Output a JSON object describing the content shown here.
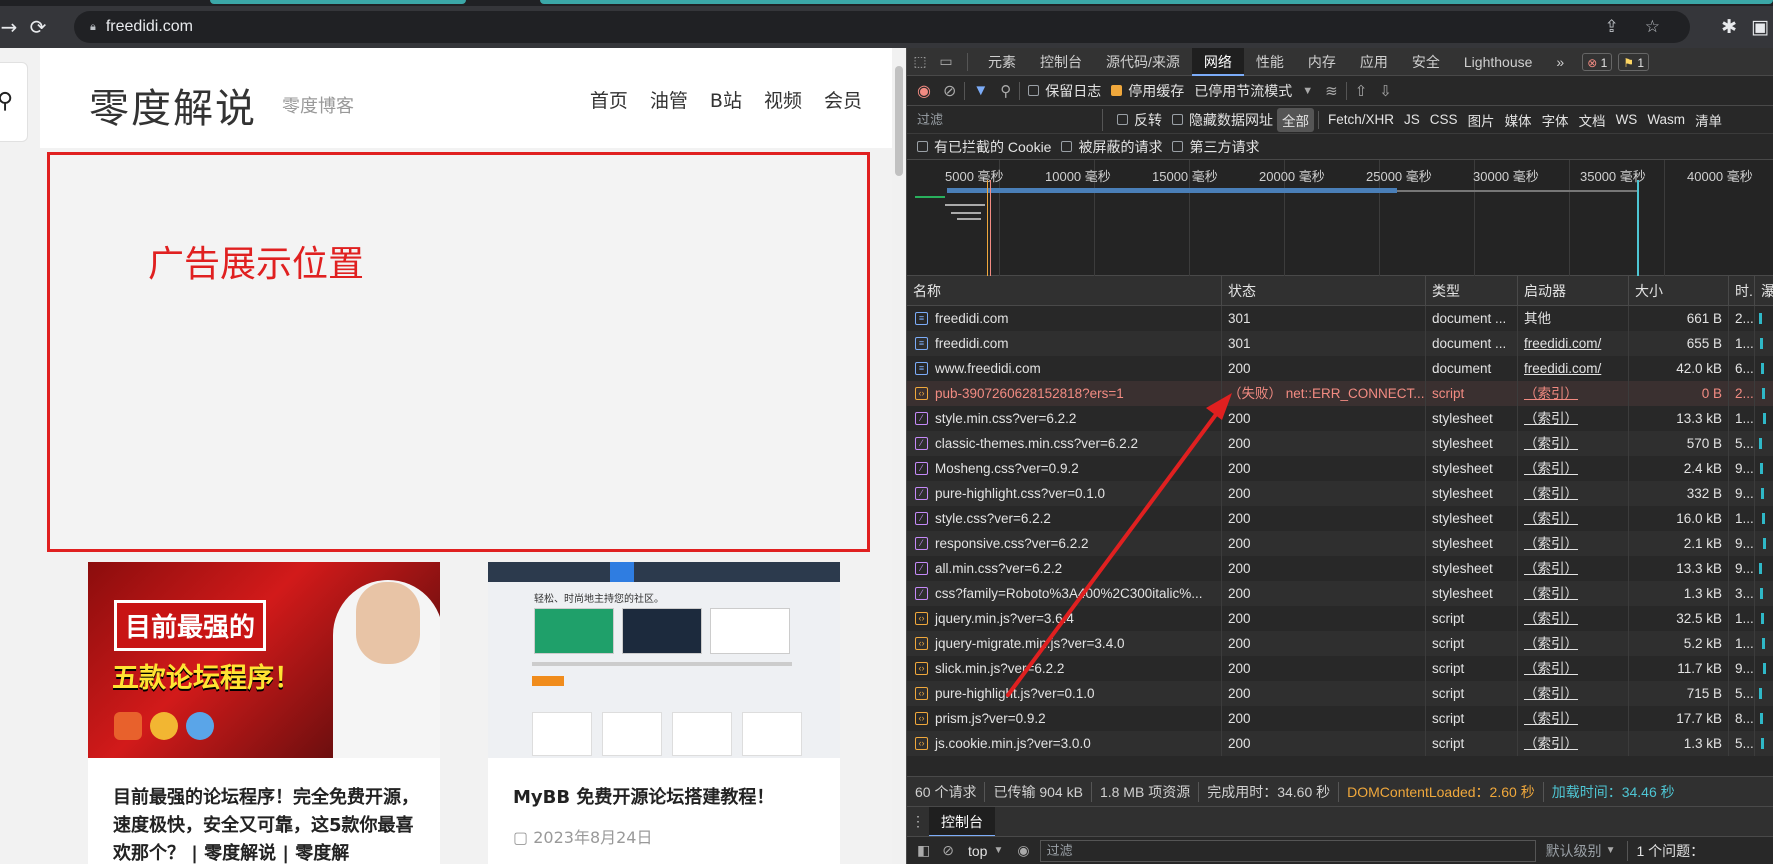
{
  "browser": {
    "url": "freedidi.com"
  },
  "page": {
    "logo": "零度解说",
    "tagline": "零度博客",
    "menu": [
      "首页",
      "油管",
      "B站",
      "视频",
      "会员"
    ],
    "ad_text": "广告展示位置",
    "cards": [
      {
        "title": "目前最强的论坛程序！完全免费开源，速度极快，安全又可靠，这5款你最喜欢那个？ | 零度解说 | 零度解",
        "thumb_line1": "目前最强的",
        "thumb_line2": "五款论坛程序！",
        "date": ""
      },
      {
        "title": "MyBB 免费开源论坛搭建教程！",
        "thumb_headline": "轻松、时尚地主持您的社区。",
        "date": "2023年8月24日"
      }
    ]
  },
  "devtools": {
    "tabs": [
      "元素",
      "控制台",
      "源代码/来源",
      "网络",
      "性能",
      "内存",
      "应用",
      "安全",
      "Lighthouse"
    ],
    "active_tab": "网络",
    "errors": "1",
    "warnings": "1",
    "toolbar": {
      "preserve_log": "保留日志",
      "disable_cache": "停用缓存",
      "throttle": "已停用节流模式"
    },
    "filter": {
      "placeholder": "过滤",
      "invert": "反转",
      "hide_data_urls": "隐藏数据网址",
      "types": [
        "全部",
        "Fetch/XHR",
        "JS",
        "CSS",
        "图片",
        "媒体",
        "字体",
        "文档",
        "WS",
        "Wasm",
        "清单"
      ]
    },
    "filter2": {
      "blocked_cookies": "有已拦截的 Cookie",
      "blocked_requests": "被屏蔽的请求",
      "third_party": "第三方请求"
    },
    "timeline_labels": [
      "5000 毫秒",
      "10000 毫秒",
      "15000 毫秒",
      "20000 毫秒",
      "25000 毫秒",
      "30000 毫秒",
      "35000 毫秒",
      "40000 毫秒"
    ],
    "columns": {
      "name": "名称",
      "status": "状态",
      "type": "类型",
      "initiator": "启动器",
      "size": "大小",
      "time": "时.",
      "waterfall": "瀑布"
    },
    "rows": [
      {
        "name": "freedidi.com",
        "status": "301",
        "type": "document ...",
        "initiator": "其他",
        "size": "661 B",
        "time": "2...",
        "kind": "doc"
      },
      {
        "name": "freedidi.com",
        "status": "301",
        "type": "document ...",
        "initiator": "freedidi.com/",
        "size": "655 B",
        "time": "1...",
        "kind": "doc"
      },
      {
        "name": "www.freedidi.com",
        "status": "200",
        "type": "document",
        "initiator": "freedidi.com/",
        "size": "42.0 kB",
        "time": "6...",
        "kind": "doc"
      },
      {
        "name": "pub-3907260628152818?ers=1",
        "status": "（失败） net::ERR_CONNECT...",
        "type": "script",
        "initiator": "（索引）",
        "size": "0 B",
        "time": "2...",
        "kind": "err"
      },
      {
        "name": "style.min.css?ver=6.2.2",
        "status": "200",
        "type": "stylesheet",
        "initiator": "（索引）",
        "size": "13.3 kB",
        "time": "1...",
        "kind": "css"
      },
      {
        "name": "classic-themes.min.css?ver=6.2.2",
        "status": "200",
        "type": "stylesheet",
        "initiator": "（索引）",
        "size": "570 B",
        "time": "5...",
        "kind": "css"
      },
      {
        "name": "Mosheng.css?ver=0.9.2",
        "status": "200",
        "type": "stylesheet",
        "initiator": "（索引）",
        "size": "2.4 kB",
        "time": "9...",
        "kind": "css"
      },
      {
        "name": "pure-highlight.css?ver=0.1.0",
        "status": "200",
        "type": "stylesheet",
        "initiator": "（索引）",
        "size": "332 B",
        "time": "9...",
        "kind": "css"
      },
      {
        "name": "style.css?ver=6.2.2",
        "status": "200",
        "type": "stylesheet",
        "initiator": "（索引）",
        "size": "16.0 kB",
        "time": "1...",
        "kind": "css"
      },
      {
        "name": "responsive.css?ver=6.2.2",
        "status": "200",
        "type": "stylesheet",
        "initiator": "（索引）",
        "size": "2.1 kB",
        "time": "9...",
        "kind": "css"
      },
      {
        "name": "all.min.css?ver=6.2.2",
        "status": "200",
        "type": "stylesheet",
        "initiator": "（索引）",
        "size": "13.3 kB",
        "time": "9...",
        "kind": "css"
      },
      {
        "name": "css?family=Roboto%3A400%2C300italic%...",
        "status": "200",
        "type": "stylesheet",
        "initiator": "（索引）",
        "size": "1.3 kB",
        "time": "3...",
        "kind": "css"
      },
      {
        "name": "jquery.min.js?ver=3.6.4",
        "status": "200",
        "type": "script",
        "initiator": "（索引）",
        "size": "32.5 kB",
        "time": "1...",
        "kind": "js"
      },
      {
        "name": "jquery-migrate.min.js?ver=3.4.0",
        "status": "200",
        "type": "script",
        "initiator": "（索引）",
        "size": "5.2 kB",
        "time": "1...",
        "kind": "js"
      },
      {
        "name": "slick.min.js?ver=6.2.2",
        "status": "200",
        "type": "script",
        "initiator": "（索引）",
        "size": "11.7 kB",
        "time": "9...",
        "kind": "js"
      },
      {
        "name": "pure-highlight.js?ver=0.1.0",
        "status": "200",
        "type": "script",
        "initiator": "（索引）",
        "size": "715 B",
        "time": "5...",
        "kind": "js"
      },
      {
        "name": "prism.js?ver=0.9.2",
        "status": "200",
        "type": "script",
        "initiator": "（索引）",
        "size": "17.7 kB",
        "time": "8...",
        "kind": "js"
      },
      {
        "name": "js.cookie.min.js?ver=3.0.0",
        "status": "200",
        "type": "script",
        "initiator": "（索引）",
        "size": "1.3 kB",
        "time": "5...",
        "kind": "js"
      }
    ],
    "summary": {
      "requests": "60 个请求",
      "transferred": "已传输 904 kB",
      "resources": "1.8 MB 项资源",
      "finish": "完成用时：34.60 秒",
      "dcl": "DOMContentLoaded：2.60 秒",
      "load": "加载时间：34.46 秒"
    },
    "drawer": {
      "tab": "控制台",
      "context": "top",
      "filter_placeholder": "过滤",
      "levels": "默认级别",
      "issues": "1 个问题："
    }
  },
  "colors": {
    "accent_red": "#e02020",
    "devtools_bg": "#282828",
    "error_text": "#f28b82"
  }
}
